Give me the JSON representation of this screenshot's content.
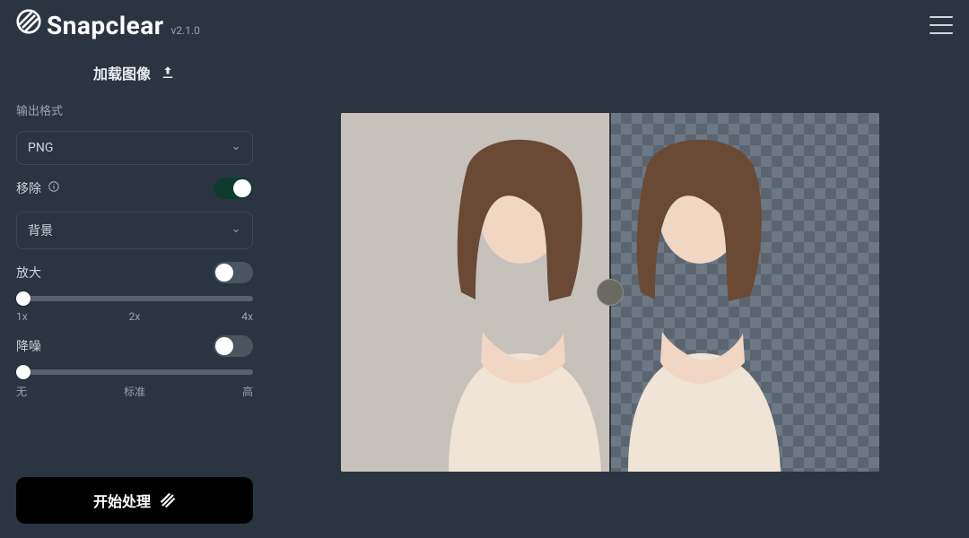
{
  "brand": {
    "name": "Snapclear",
    "version": "v2.1.0"
  },
  "load_image_label": "加载图像",
  "output_format": {
    "label": "输出格式",
    "selected": "PNG"
  },
  "remove": {
    "label": "移除",
    "enabled": true,
    "target_selected": "背景"
  },
  "upscale": {
    "label": "放大",
    "enabled": false,
    "value_index": 0,
    "ticks": [
      "1x",
      "2x",
      "4x"
    ]
  },
  "denoise": {
    "label": "降噪",
    "enabled": false,
    "value_index": 0,
    "ticks": [
      "无",
      "标准",
      "高"
    ]
  },
  "process_button": "开始处理",
  "preview": {
    "split_percent": 50
  }
}
